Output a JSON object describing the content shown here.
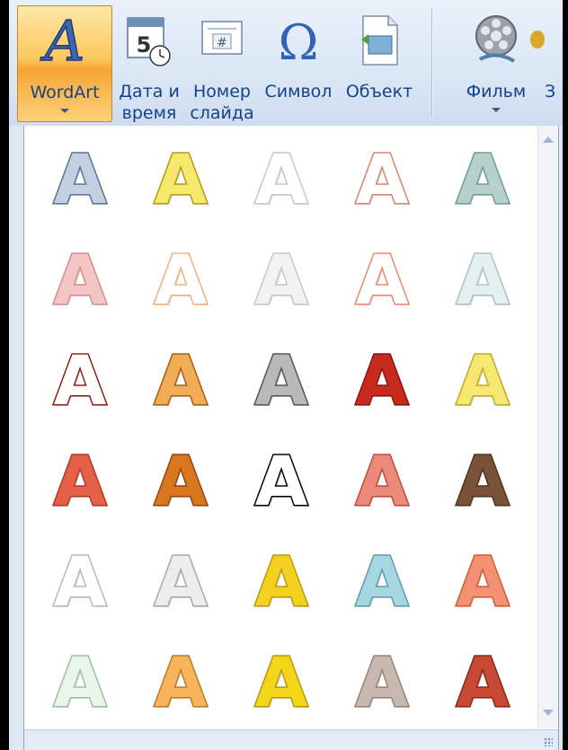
{
  "ribbon": {
    "buttons": [
      {
        "id": "wordart",
        "label": "WordArt",
        "icon": "wordart-icon",
        "active": true,
        "dropdown": true
      },
      {
        "id": "datetime",
        "label_line1": "Дата и",
        "label_line2": "время",
        "icon": "calendar-clock-icon"
      },
      {
        "id": "slidenumber",
        "label_line1": "Номер",
        "label_line2": "слайда",
        "icon": "slide-number-icon"
      },
      {
        "id": "symbol",
        "label": "Символ",
        "icon": "omega-icon"
      },
      {
        "id": "object",
        "label": "Объект",
        "icon": "insert-object-icon"
      },
      {
        "id": "movie",
        "label": "Фильм",
        "icon": "film-reel-icon",
        "dropdown": true
      },
      {
        "id": "sound",
        "label": "З",
        "icon": "sound-icon"
      }
    ]
  },
  "gallery": {
    "letter": "A",
    "styles": [
      {
        "fill": "#c3d0e2",
        "stroke": "#5d7396"
      },
      {
        "fill": "#f6e86a",
        "stroke": "#b39a12"
      },
      {
        "fill": "#ffffff",
        "stroke": "#c7c7c7"
      },
      {
        "fill": "#ffffff",
        "stroke": "#d9836f"
      },
      {
        "fill": "#b8d0cc",
        "stroke": "#6f9c96"
      },
      {
        "fill": "#f3c6c6",
        "stroke": "#d98a8a"
      },
      {
        "fill": "#ffffff",
        "stroke": "#f2b27a"
      },
      {
        "fill": "#f2f2f2",
        "stroke": "#c8c8c8"
      },
      {
        "fill": "#ffffff",
        "stroke": "#f0876c"
      },
      {
        "fill": "#e4eff0",
        "stroke": "#a9c3c6"
      },
      {
        "fill": "#ffffff",
        "stroke": "#8e1f12"
      },
      {
        "fill": "#f1ad55",
        "stroke": "#a85c15"
      },
      {
        "fill": "#b9b9b9",
        "stroke": "#555555"
      },
      {
        "fill": "#c82a1e",
        "stroke": "#861510"
      },
      {
        "fill": "#f6e770",
        "stroke": "#c7a722"
      },
      {
        "fill": "#e46148",
        "stroke": "#b03a24"
      },
      {
        "fill": "#d9771f",
        "stroke": "#94460c"
      },
      {
        "fill": "#ffffff",
        "stroke": "#000000"
      },
      {
        "fill": "#eb8a7a",
        "stroke": "#c04b3a"
      },
      {
        "fill": "#7a5238",
        "stroke": "#4f3322"
      },
      {
        "fill": "#ffffff",
        "stroke": "#b9b9b9"
      },
      {
        "fill": "#ededed",
        "stroke": "#a8a8a8"
      },
      {
        "fill": "#f2d21f",
        "stroke": "#b99b10"
      },
      {
        "fill": "#a6d6e0",
        "stroke": "#5f9ca9"
      },
      {
        "fill": "#f39173",
        "stroke": "#d15a38"
      },
      {
        "fill": "#eaf5ea",
        "stroke": "#98c3a0"
      },
      {
        "fill": "#f6b45c",
        "stroke": "#c4771f"
      },
      {
        "fill": "#f3d51a",
        "stroke": "#b99710"
      },
      {
        "fill": "#c9b8ae",
        "stroke": "#9a8273"
      },
      {
        "fill": "#c64a33",
        "stroke": "#8b2716"
      }
    ]
  }
}
